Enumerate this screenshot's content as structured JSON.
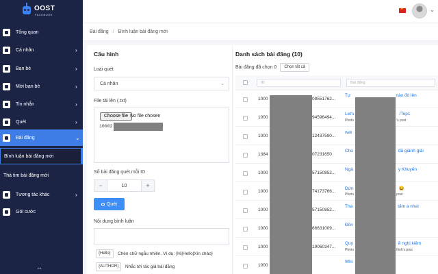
{
  "app": {
    "brand": "OOST",
    "brand_sub": "FACEBOOK"
  },
  "sidebar": {
    "items": [
      {
        "label": "Tổng quan",
        "icon": "grid-icon"
      },
      {
        "label": "Cá nhân",
        "icon": "user-icon"
      },
      {
        "label": "Bạn bè",
        "icon": "users-icon"
      },
      {
        "label": "Mời bạn bè",
        "icon": "send-icon"
      },
      {
        "label": "Tin nhắn",
        "icon": "message-icon"
      },
      {
        "label": "Quét",
        "icon": "scan-icon"
      },
      {
        "label": "Bài đăng",
        "icon": "document-icon"
      },
      {
        "label": "Bình luận bài đăng mới"
      },
      {
        "label": "Thả tim bài đăng mới"
      },
      {
        "label": "Tương tác khác",
        "icon": "interaction-icon"
      },
      {
        "label": "Gói cước",
        "icon": "package-icon"
      }
    ],
    "collapse_symbol": "↔"
  },
  "topbar": {
    "language": "vi",
    "flag_color": "#da251d"
  },
  "breadcrumb": {
    "items": [
      "Bài đăng",
      "Bình luận bài đăng mới"
    ],
    "separator": "/"
  },
  "config": {
    "title": "Cấu hình",
    "scan_type_label": "Loại quét",
    "scan_type_value": "Cá nhân",
    "file_label": "File tải lên (.txt)",
    "file_button": "Choose file",
    "file_status": "No file chosen",
    "file_content_prefix": "10002",
    "count_label": "Số bài đăng quét mỗi ID",
    "count_value": "10",
    "minus": "−",
    "plus": "+",
    "scan_button": "Quét",
    "comment_label": "Nội dung bình luận",
    "hint_random_tag": "{Hello}",
    "hint_random_text": "Chèn chữ ngẫu nhiên. Ví dụ: {Hi|Hello|Xin chào}",
    "hint_author_tag": "{AUTHOR}",
    "hint_author_text": "Nhắc tới tác giả bài đăng"
  },
  "posts": {
    "title": "Danh sách bài đăng (10)",
    "selected_label": "Bài đăng đã chọn 0",
    "select_all_button": "Chọn tất cả",
    "filter_id_placeholder": "ID",
    "filter_post_placeholder": "Bài đăng",
    "rows": [
      {
        "id": "1000",
        "uid": "08551762...",
        "post": "Tự",
        "post_tail": "nào đó lên",
        "meta": ""
      },
      {
        "id": "1000",
        "uid": "94596494...",
        "post": "Let's",
        "post_tail": "/Top1",
        "meta": "Photo",
        "meta_tail": "'s post"
      },
      {
        "id": "1000",
        "uid": "12437590...",
        "post": "wat",
        "post_tail": "",
        "meta": ""
      },
      {
        "id": "1384",
        "uid": "07231650",
        "post": "Chú",
        "post_tail": "đã giành giải",
        "meta": ""
      },
      {
        "id": "1000",
        "uid": "57150852...",
        "post": "Ngà",
        "post_tail": "y Khuyến",
        "meta": ""
      },
      {
        "id": "1000",
        "uid": "74173766...",
        "post": "Đứn",
        "post_tail": "😀",
        "meta": "Photo",
        "meta_tail": "post"
      },
      {
        "id": "1000",
        "uid": "57150852...",
        "post": "Tha",
        "post_tail": "tấm a nha!",
        "meta": ""
      },
      {
        "id": "1000",
        "uid": "66631009...",
        "post": "Đồn",
        "post_tail": "",
        "meta": ""
      },
      {
        "id": "1000",
        "uid": "19060347...",
        "post": "Quy",
        "post_tail": "ề nghị kiếm",
        "meta": "Photo",
        "meta_tail": "fiình's post"
      },
      {
        "id": "1000",
        "uid": "",
        "post": "Whi",
        "post_tail": "",
        "meta": ""
      }
    ]
  },
  "colors": {
    "sidebar_bg": "#1c2446",
    "accent": "#3e7de6",
    "link": "#1a73e8",
    "redaction": "#808080"
  }
}
